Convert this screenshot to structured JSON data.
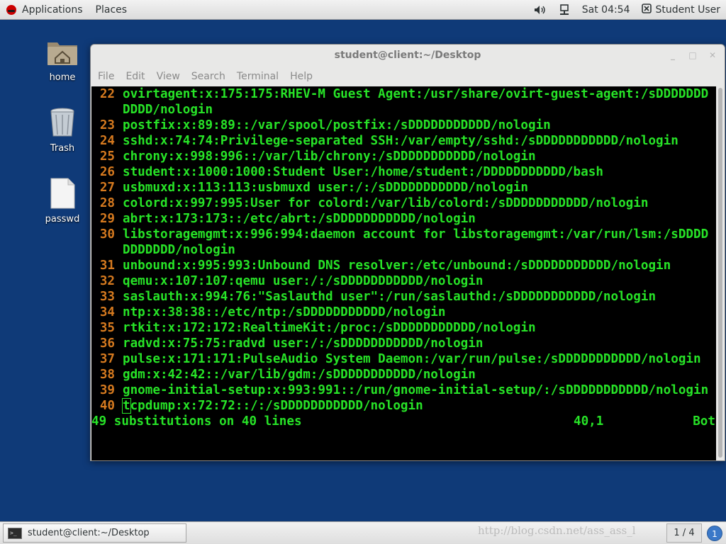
{
  "top_panel": {
    "applications_label": "Applications",
    "places_label": "Places",
    "clock": "Sat 04:54",
    "user_name": "Student User"
  },
  "desktop": {
    "icons": [
      {
        "label": "home"
      },
      {
        "label": "Trash"
      },
      {
        "label": "passwd"
      }
    ]
  },
  "terminal": {
    "title": "student@client:~/Desktop",
    "menu": [
      "File",
      "Edit",
      "View",
      "Search",
      "Terminal",
      "Help"
    ],
    "lines": [
      {
        "num": "22",
        "text": "ovirtagent:x:175:175:RHEV-M Guest Agent:/usr/share/ovirt-guest-agent:/sDDDDDDDDDDD/nologin"
      },
      {
        "num": "23",
        "text": "postfix:x:89:89::/var/spool/postfix:/sDDDDDDDDDDD/nologin"
      },
      {
        "num": "24",
        "text": "sshd:x:74:74:Privilege-separated SSH:/var/empty/sshd:/sDDDDDDDDDDD/nologin"
      },
      {
        "num": "25",
        "text": "chrony:x:998:996::/var/lib/chrony:/sDDDDDDDDDDD/nologin"
      },
      {
        "num": "26",
        "text": "student:x:1000:1000:Student User:/home/student:/DDDDDDDDDDD/bash"
      },
      {
        "num": "27",
        "text": "usbmuxd:x:113:113:usbmuxd user:/:/sDDDDDDDDDDD/nologin"
      },
      {
        "num": "28",
        "text": "colord:x:997:995:User for colord:/var/lib/colord:/sDDDDDDDDDDD/nologin"
      },
      {
        "num": "29",
        "text": "abrt:x:173:173::/etc/abrt:/sDDDDDDDDDDD/nologin"
      },
      {
        "num": "30",
        "text": "libstoragemgmt:x:996:994:daemon account for libstoragemgmt:/var/run/lsm:/sDDDDDDDDDDD/nologin"
      },
      {
        "num": "31",
        "text": "unbound:x:995:993:Unbound DNS resolver:/etc/unbound:/sDDDDDDDDDDD/nologin"
      },
      {
        "num": "32",
        "text": "qemu:x:107:107:qemu user:/:/sDDDDDDDDDDD/nologin"
      },
      {
        "num": "33",
        "text": "saslauth:x:994:76:\"Saslauthd user\":/run/saslauthd:/sDDDDDDDDDDD/nologin"
      },
      {
        "num": "34",
        "text": "ntp:x:38:38::/etc/ntp:/sDDDDDDDDDDD/nologin"
      },
      {
        "num": "35",
        "text": "rtkit:x:172:172:RealtimeKit:/proc:/sDDDDDDDDDDD/nologin"
      },
      {
        "num": "36",
        "text": "radvd:x:75:75:radvd user:/:/sDDDDDDDDDDD/nologin"
      },
      {
        "num": "37",
        "text": "pulse:x:171:171:PulseAudio System Daemon:/var/run/pulse:/sDDDDDDDDDDD/nologin"
      },
      {
        "num": "38",
        "text": "gdm:x:42:42::/var/lib/gdm:/sDDDDDDDDDDD/nologin"
      },
      {
        "num": "39",
        "text": "gnome-initial-setup:x:993:991::/run/gnome-initial-setup/:/sDDDDDDDDDDD/nologin"
      }
    ],
    "cursor_line": {
      "num": "40",
      "cursor_char": "t",
      "rest": "cpdump:x:72:72::/:/sDDDDDDDDDDD/nologin"
    },
    "status": {
      "message": "49 substitutions on 40 lines",
      "position": "40,1",
      "scroll": "Bot"
    }
  },
  "bottom_panel": {
    "task_label": "student@client:~/Desktop",
    "watermark": "http://blog.csdn.net/ass_ass_l",
    "workspace": "1 / 4",
    "notify_count": "1"
  }
}
